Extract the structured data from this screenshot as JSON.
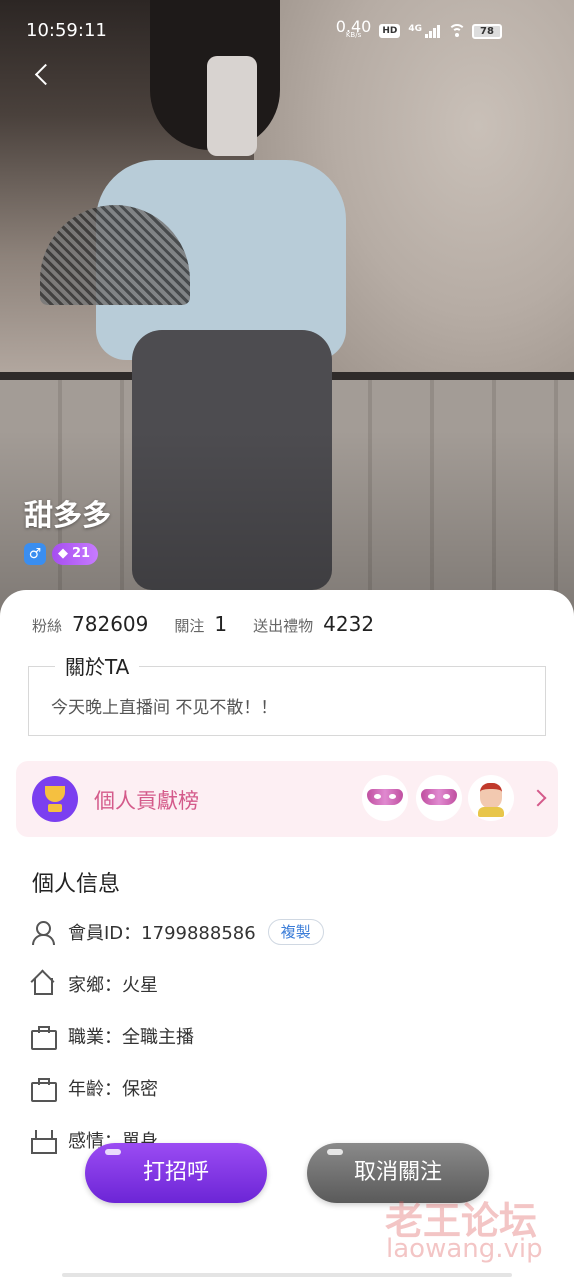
{
  "status_bar": {
    "time": "10:59:11",
    "net_speed_value": "0.40",
    "net_speed_unit": "KB/s",
    "hd_label": "HD",
    "network_label": "4G",
    "battery_level": "78"
  },
  "profile": {
    "name": "甜多多",
    "gender_symbol": "♂",
    "level": "21"
  },
  "stats": {
    "fans_label": "粉絲",
    "fans_value": "782609",
    "following_label": "關注",
    "following_value": "1",
    "gifts_label": "送出禮物",
    "gifts_value": "4232"
  },
  "about": {
    "title": "關於TA",
    "text": "今天晚上直播间 不见不散！！"
  },
  "contribution": {
    "label": "個人貢獻榜"
  },
  "personal_info": {
    "title": "個人信息",
    "member_id": "會員ID：1799888586",
    "copy_label": "複製",
    "hometown": "家鄉：火星",
    "occupation": "職業：全職主播",
    "age": "年齡：保密",
    "relationship": "感情：單身"
  },
  "actions": {
    "greet_label": "打招呼",
    "unfollow_label": "取消關注"
  },
  "watermark": {
    "text": "老王论坛",
    "sub": "laowang.vip"
  },
  "colors": {
    "accent_purple": "#7b3ff0",
    "contrib_pink": "#d45a8a",
    "copy_blue": "#3b7dd8"
  }
}
